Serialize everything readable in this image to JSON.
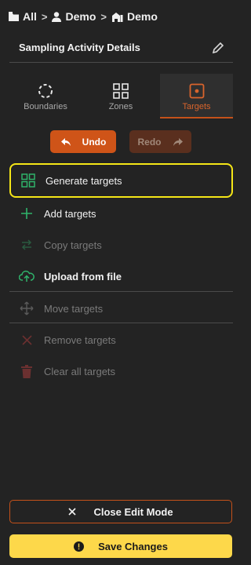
{
  "breadcrumb": {
    "items": [
      {
        "label": "All",
        "icon": "folder-icon"
      },
      {
        "label": "Demo",
        "icon": "person-icon"
      },
      {
        "label": "Demo",
        "icon": "farm-icon"
      }
    ],
    "separator": ">"
  },
  "header": {
    "title": "Sampling Activity Details",
    "edit_icon": "pencil-icon"
  },
  "tabs": [
    {
      "label": "Boundaries",
      "icon": "boundary-icon",
      "active": false
    },
    {
      "label": "Zones",
      "icon": "zones-grid-icon",
      "active": false
    },
    {
      "label": "Targets",
      "icon": "target-icon",
      "active": true
    }
  ],
  "history": {
    "undo_label": "Undo",
    "redo_label": "Redo",
    "undo_icon": "undo-arrow-icon",
    "redo_icon": "redo-arrow-icon"
  },
  "actions": [
    {
      "label": "Generate targets",
      "icon": "grid-icon",
      "enabled": true,
      "highlighted": true
    },
    {
      "label": "Add targets",
      "icon": "plus-icon",
      "enabled": true
    },
    {
      "label": "Copy targets",
      "icon": "swap-arrows-icon",
      "enabled": false
    },
    {
      "label": "Upload from file",
      "icon": "cloud-upload-icon",
      "enabled": true
    },
    {
      "label": "Move targets",
      "icon": "move-icon",
      "enabled": false
    },
    {
      "label": "Remove targets",
      "icon": "x-icon",
      "enabled": false
    },
    {
      "label": "Clear all targets",
      "icon": "trash-icon",
      "enabled": false
    }
  ],
  "footer": {
    "close_label": "Close Edit Mode",
    "save_label": "Save Changes",
    "close_icon": "close-icon",
    "save_icon": "alert-circle-icon"
  },
  "colors": {
    "accent": "#cf5418",
    "green": "#2fb36b",
    "save": "#fdd84a",
    "highlight": "#f5e617"
  }
}
